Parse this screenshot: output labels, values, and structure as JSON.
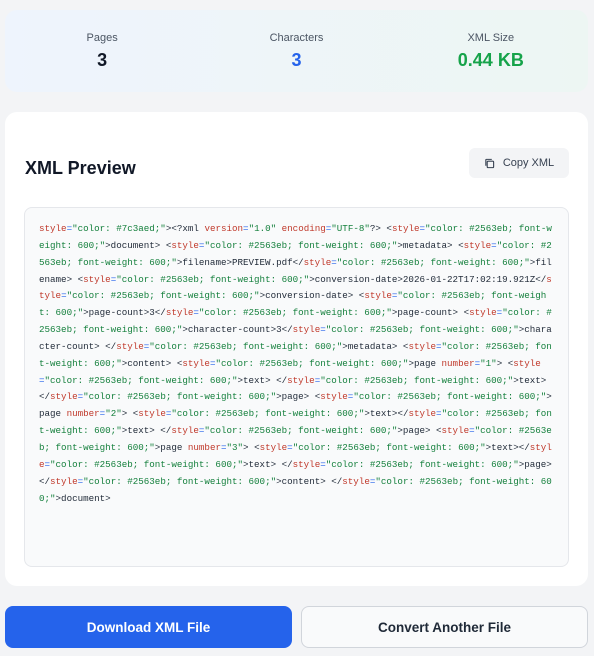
{
  "stats": {
    "pages": {
      "label": "Pages",
      "value": "3"
    },
    "characters": {
      "label": "Characters",
      "value": "3"
    },
    "xml_size": {
      "label": "XML Size",
      "value": "0.44 KB"
    }
  },
  "preview": {
    "title": "XML Preview",
    "copy_label": "Copy XML",
    "copy_icon": "copy-icon",
    "code_segments": [
      [
        "attr",
        "style"
      ],
      [
        "sym",
        "="
      ],
      [
        "str",
        "\"color: #7c3aed;\""
      ],
      [
        "text",
        "><?xml "
      ],
      [
        "attr",
        "version"
      ],
      [
        "sym",
        "="
      ],
      [
        "str",
        "\"1.0\""
      ],
      [
        "text",
        " "
      ],
      [
        "attr",
        "encoding"
      ],
      [
        "sym",
        "="
      ],
      [
        "str",
        "\"UTF-8\""
      ],
      [
        "text",
        "?> <"
      ],
      [
        "attr",
        "style"
      ],
      [
        "sym",
        "="
      ],
      [
        "str",
        "\"color: #2563eb; font-weight: 600;\""
      ],
      [
        "text",
        ">document> <"
      ],
      [
        "attr",
        "style"
      ],
      [
        "sym",
        "="
      ],
      [
        "str",
        "\"color: #2563eb; font-weight: 600;\""
      ],
      [
        "text",
        ">metadata> <"
      ],
      [
        "attr",
        "style"
      ],
      [
        "sym",
        "="
      ],
      [
        "str",
        "\"color: #2563eb; font-weight: 600;\""
      ],
      [
        "text",
        ">filename>PREVIEW.pdf</"
      ],
      [
        "attr",
        "style"
      ],
      [
        "sym",
        "="
      ],
      [
        "str",
        "\"color: #2563eb; font-weight: 600;\""
      ],
      [
        "text",
        ">filename> <"
      ],
      [
        "attr",
        "style"
      ],
      [
        "sym",
        "="
      ],
      [
        "str",
        "\"color: #2563eb; font-weight: 600;\""
      ],
      [
        "text",
        ">conversion-date>2026-01-22T17:02:19.921Z</"
      ],
      [
        "attr",
        "style"
      ],
      [
        "sym",
        "="
      ],
      [
        "str",
        "\"color: #2563eb; font-weight: 600;\""
      ],
      [
        "text",
        ">conversion-date> <"
      ],
      [
        "attr",
        "style"
      ],
      [
        "sym",
        "="
      ],
      [
        "str",
        "\"color: #2563eb; font-weight: 600;\""
      ],
      [
        "text",
        ">page-count>3</"
      ],
      [
        "attr",
        "style"
      ],
      [
        "sym",
        "="
      ],
      [
        "str",
        "\"color: #2563eb; font-weight: 600;\""
      ],
      [
        "text",
        ">page-count> <"
      ],
      [
        "attr",
        "style"
      ],
      [
        "sym",
        "="
      ],
      [
        "str",
        "\"color: #2563eb; font-weight: 600;\""
      ],
      [
        "text",
        ">character-count>3</"
      ],
      [
        "attr",
        "style"
      ],
      [
        "sym",
        "="
      ],
      [
        "str",
        "\"color: #2563eb; font-weight: 600;\""
      ],
      [
        "text",
        ">character-count> </"
      ],
      [
        "attr",
        "style"
      ],
      [
        "sym",
        "="
      ],
      [
        "str",
        "\"color: #2563eb; font-weight: 600;\""
      ],
      [
        "text",
        ">metadata> <"
      ],
      [
        "attr",
        "style"
      ],
      [
        "sym",
        "="
      ],
      [
        "str",
        "\"color: #2563eb; font-weight: 600;\""
      ],
      [
        "text",
        ">content> <"
      ],
      [
        "attr",
        "style"
      ],
      [
        "sym",
        "="
      ],
      [
        "str",
        "\"color: #2563eb; font-weight: 600;\""
      ],
      [
        "text",
        ">page "
      ],
      [
        "attr",
        "number"
      ],
      [
        "sym",
        "="
      ],
      [
        "str",
        "\"1\""
      ],
      [
        "text",
        "> <"
      ],
      [
        "attr",
        "style"
      ],
      [
        "sym",
        "="
      ],
      [
        "str",
        "\"color: #2563eb; font-weight: 600;\""
      ],
      [
        "text",
        ">text> </"
      ],
      [
        "attr",
        "style"
      ],
      [
        "sym",
        "="
      ],
      [
        "str",
        "\"color: #2563eb; font-weight: 600;\""
      ],
      [
        "text",
        ">text> </"
      ],
      [
        "attr",
        "style"
      ],
      [
        "sym",
        "="
      ],
      [
        "str",
        "\"color: #2563eb; font-weight: 600;\""
      ],
      [
        "text",
        ">page> <"
      ],
      [
        "attr",
        "style"
      ],
      [
        "sym",
        "="
      ],
      [
        "str",
        "\"color: #2563eb; font-weight: 600;\""
      ],
      [
        "text",
        ">page "
      ],
      [
        "attr",
        "number"
      ],
      [
        "sym",
        "="
      ],
      [
        "str",
        "\"2\""
      ],
      [
        "text",
        "> <"
      ],
      [
        "attr",
        "style"
      ],
      [
        "sym",
        "="
      ],
      [
        "str",
        "\"color: #2563eb; font-weight: 600;\""
      ],
      [
        "text",
        ">text></"
      ],
      [
        "attr",
        "style"
      ],
      [
        "sym",
        "="
      ],
      [
        "str",
        "\"color: #2563eb; font-weight: 600;\""
      ],
      [
        "text",
        ">text> </"
      ],
      [
        "attr",
        "style"
      ],
      [
        "sym",
        "="
      ],
      [
        "str",
        "\"color: #2563eb; font-weight: 600;\""
      ],
      [
        "text",
        ">page> <"
      ],
      [
        "attr",
        "style"
      ],
      [
        "sym",
        "="
      ],
      [
        "str",
        "\"color: #2563eb; font-weight: 600;\""
      ],
      [
        "text",
        ">page "
      ],
      [
        "attr",
        "number"
      ],
      [
        "sym",
        "="
      ],
      [
        "str",
        "\"3\""
      ],
      [
        "text",
        "> <"
      ],
      [
        "attr",
        "style"
      ],
      [
        "sym",
        "="
      ],
      [
        "str",
        "\"color: #2563eb; font-weight: 600;\""
      ],
      [
        "text",
        ">text></"
      ],
      [
        "attr",
        "style"
      ],
      [
        "sym",
        "="
      ],
      [
        "str",
        "\"color: #2563eb; font-weight: 600;\""
      ],
      [
        "text",
        ">text> </"
      ],
      [
        "attr",
        "style"
      ],
      [
        "sym",
        "="
      ],
      [
        "str",
        "\"color: #2563eb; font-weight: 600;\""
      ],
      [
        "text",
        ">page> </"
      ],
      [
        "attr",
        "style"
      ],
      [
        "sym",
        "="
      ],
      [
        "str",
        "\"color: #2563eb; font-weight: 600;\""
      ],
      [
        "text",
        ">content> </"
      ],
      [
        "attr",
        "style"
      ],
      [
        "sym",
        "="
      ],
      [
        "str",
        "\"color: #2563eb; font-weight: 600;\""
      ],
      [
        "text",
        ">document>"
      ]
    ]
  },
  "actions": {
    "download_label": "Download XML File",
    "convert_label": "Convert Another File"
  },
  "colors": {
    "accent": "#2563eb",
    "success": "#16a34a",
    "code_attr": "#c0392b",
    "code_string": "#15803d"
  }
}
